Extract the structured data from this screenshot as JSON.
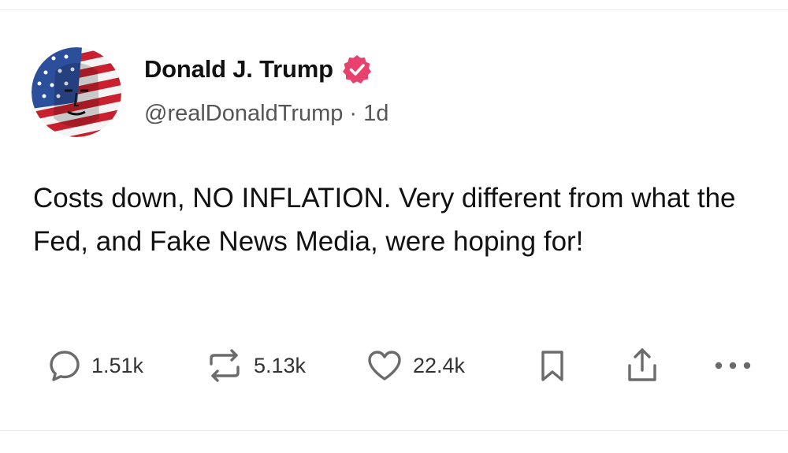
{
  "post": {
    "author": {
      "display_name": "Donald J. Trump",
      "handle": "@realDonaldTrump",
      "separator": "·",
      "age": "1d",
      "verified": true,
      "verified_color": "#e8416e",
      "avatar_icon": "flag-portrait-avatar"
    },
    "text": "Costs down, NO INFLATION. Very different from what the Fed, and Fake News Media, were hoping for!",
    "actions": {
      "replies": {
        "icon": "reply-bubble-icon",
        "count": "1.51k"
      },
      "reposts": {
        "icon": "repost-icon",
        "count": "5.13k"
      },
      "likes": {
        "icon": "heart-icon",
        "count": "22.4k"
      },
      "bookmark": {
        "icon": "bookmark-icon"
      },
      "share": {
        "icon": "share-icon"
      },
      "more": {
        "icon": "more-dots-icon"
      }
    }
  },
  "colors": {
    "icon_gray": "#6b6b6b",
    "text": "#111111",
    "handle": "#555555"
  }
}
